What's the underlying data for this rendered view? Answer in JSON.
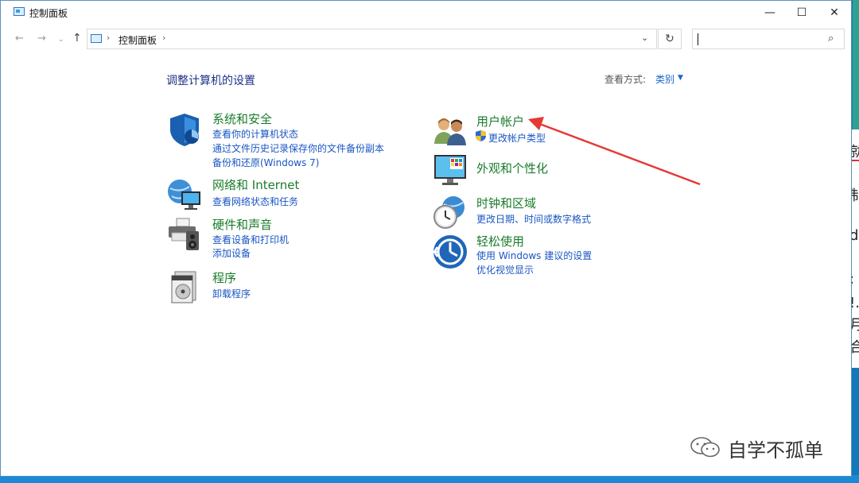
{
  "window": {
    "title": "控制面板",
    "controls": {
      "minimize": "—",
      "maximize": "☐",
      "close": "✕"
    }
  },
  "nav": {
    "back": "←",
    "forward": "→",
    "recent": "⌄",
    "up": "↑",
    "breadcrumb": [
      "控制面板"
    ],
    "separator": "›",
    "dropdown": "⌄",
    "refresh": "↻",
    "search_placeholder": ""
  },
  "main": {
    "heading": "调整计算机的设置",
    "view_by": {
      "label": "查看方式:",
      "value": "类别"
    }
  },
  "categories_left": [
    {
      "title": "系统和安全",
      "links": [
        "查看你的计算机状态",
        "通过文件历史记录保存你的文件备份副本",
        "备份和还原(Windows 7)"
      ]
    },
    {
      "title": "网络和 Internet",
      "links": [
        "查看网络状态和任务"
      ]
    },
    {
      "title": "硬件和声音",
      "links": [
        "查看设备和打印机",
        "添加设备"
      ]
    },
    {
      "title": "程序",
      "links": [
        "卸载程序"
      ]
    }
  ],
  "categories_right": [
    {
      "title": "用户帐户",
      "links": [
        "更改帐户类型"
      ]
    },
    {
      "title": "外观和个性化",
      "links": []
    },
    {
      "title": "时钟和区域",
      "links": [
        "更改日期、时间或数字格式"
      ]
    },
    {
      "title": "轻松使用",
      "links": [
        "使用 Windows 建议的设置",
        "优化视觉显示"
      ]
    }
  ],
  "background_doc": {
    "glyphs": [
      "勍",
      "制",
      "d",
      ":",
      "!.",
      "月",
      "合"
    ]
  },
  "watermark": {
    "text": "自学不孤单"
  },
  "colors": {
    "category_title": "#1a7c2b",
    "link": "#1a56c4",
    "heading": "#1e3287",
    "arrow": "#e53935"
  }
}
